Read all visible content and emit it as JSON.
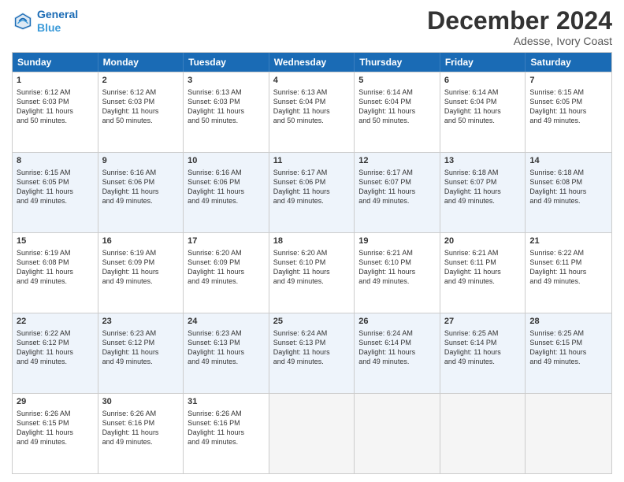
{
  "logo": {
    "line1": "General",
    "line2": "Blue"
  },
  "title": "December 2024",
  "location": "Adesse, Ivory Coast",
  "days_of_week": [
    "Sunday",
    "Monday",
    "Tuesday",
    "Wednesday",
    "Thursday",
    "Friday",
    "Saturday"
  ],
  "weeks": [
    [
      {
        "day": "1",
        "sunrise": "6:12 AM",
        "sunset": "6:03 PM",
        "daylight": "11 hours and 50 minutes."
      },
      {
        "day": "2",
        "sunrise": "6:12 AM",
        "sunset": "6:03 PM",
        "daylight": "11 hours and 50 minutes."
      },
      {
        "day": "3",
        "sunrise": "6:13 AM",
        "sunset": "6:03 PM",
        "daylight": "11 hours and 50 minutes."
      },
      {
        "day": "4",
        "sunrise": "6:13 AM",
        "sunset": "6:04 PM",
        "daylight": "11 hours and 50 minutes."
      },
      {
        "day": "5",
        "sunrise": "6:14 AM",
        "sunset": "6:04 PM",
        "daylight": "11 hours and 50 minutes."
      },
      {
        "day": "6",
        "sunrise": "6:14 AM",
        "sunset": "6:04 PM",
        "daylight": "11 hours and 50 minutes."
      },
      {
        "day": "7",
        "sunrise": "6:15 AM",
        "sunset": "6:05 PM",
        "daylight": "11 hours and 49 minutes."
      }
    ],
    [
      {
        "day": "8",
        "sunrise": "6:15 AM",
        "sunset": "6:05 PM",
        "daylight": "11 hours and 49 minutes."
      },
      {
        "day": "9",
        "sunrise": "6:16 AM",
        "sunset": "6:06 PM",
        "daylight": "11 hours and 49 minutes."
      },
      {
        "day": "10",
        "sunrise": "6:16 AM",
        "sunset": "6:06 PM",
        "daylight": "11 hours and 49 minutes."
      },
      {
        "day": "11",
        "sunrise": "6:17 AM",
        "sunset": "6:06 PM",
        "daylight": "11 hours and 49 minutes."
      },
      {
        "day": "12",
        "sunrise": "6:17 AM",
        "sunset": "6:07 PM",
        "daylight": "11 hours and 49 minutes."
      },
      {
        "day": "13",
        "sunrise": "6:18 AM",
        "sunset": "6:07 PM",
        "daylight": "11 hours and 49 minutes."
      },
      {
        "day": "14",
        "sunrise": "6:18 AM",
        "sunset": "6:08 PM",
        "daylight": "11 hours and 49 minutes."
      }
    ],
    [
      {
        "day": "15",
        "sunrise": "6:19 AM",
        "sunset": "6:08 PM",
        "daylight": "11 hours and 49 minutes."
      },
      {
        "day": "16",
        "sunrise": "6:19 AM",
        "sunset": "6:09 PM",
        "daylight": "11 hours and 49 minutes."
      },
      {
        "day": "17",
        "sunrise": "6:20 AM",
        "sunset": "6:09 PM",
        "daylight": "11 hours and 49 minutes."
      },
      {
        "day": "18",
        "sunrise": "6:20 AM",
        "sunset": "6:10 PM",
        "daylight": "11 hours and 49 minutes."
      },
      {
        "day": "19",
        "sunrise": "6:21 AM",
        "sunset": "6:10 PM",
        "daylight": "11 hours and 49 minutes."
      },
      {
        "day": "20",
        "sunrise": "6:21 AM",
        "sunset": "6:11 PM",
        "daylight": "11 hours and 49 minutes."
      },
      {
        "day": "21",
        "sunrise": "6:22 AM",
        "sunset": "6:11 PM",
        "daylight": "11 hours and 49 minutes."
      }
    ],
    [
      {
        "day": "22",
        "sunrise": "6:22 AM",
        "sunset": "6:12 PM",
        "daylight": "11 hours and 49 minutes."
      },
      {
        "day": "23",
        "sunrise": "6:23 AM",
        "sunset": "6:12 PM",
        "daylight": "11 hours and 49 minutes."
      },
      {
        "day": "24",
        "sunrise": "6:23 AM",
        "sunset": "6:13 PM",
        "daylight": "11 hours and 49 minutes."
      },
      {
        "day": "25",
        "sunrise": "6:24 AM",
        "sunset": "6:13 PM",
        "daylight": "11 hours and 49 minutes."
      },
      {
        "day": "26",
        "sunrise": "6:24 AM",
        "sunset": "6:14 PM",
        "daylight": "11 hours and 49 minutes."
      },
      {
        "day": "27",
        "sunrise": "6:25 AM",
        "sunset": "6:14 PM",
        "daylight": "11 hours and 49 minutes."
      },
      {
        "day": "28",
        "sunrise": "6:25 AM",
        "sunset": "6:15 PM",
        "daylight": "11 hours and 49 minutes."
      }
    ],
    [
      {
        "day": "29",
        "sunrise": "6:26 AM",
        "sunset": "6:15 PM",
        "daylight": "11 hours and 49 minutes."
      },
      {
        "day": "30",
        "sunrise": "6:26 AM",
        "sunset": "6:16 PM",
        "daylight": "11 hours and 49 minutes."
      },
      {
        "day": "31",
        "sunrise": "6:26 AM",
        "sunset": "6:16 PM",
        "daylight": "11 hours and 49 minutes."
      },
      null,
      null,
      null,
      null
    ]
  ]
}
